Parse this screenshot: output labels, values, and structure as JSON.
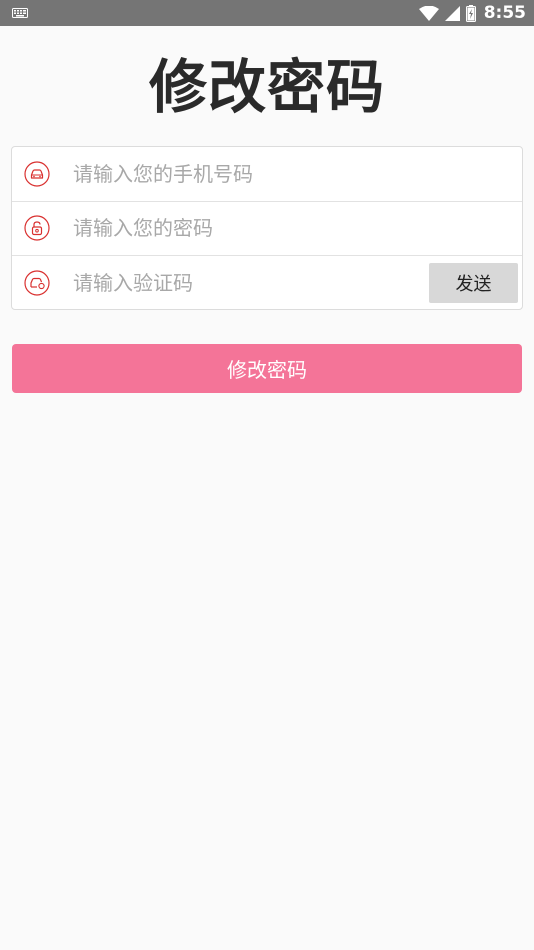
{
  "status_bar": {
    "time": "8:55",
    "icons": [
      "keyboard-icon",
      "wifi-icon",
      "signal-icon",
      "battery-icon"
    ],
    "background": "#757575"
  },
  "page": {
    "title": "修改密码"
  },
  "form": {
    "phone": {
      "placeholder": "请输入您的手机号码",
      "value": "",
      "icon": "car-icon"
    },
    "password": {
      "placeholder": "请输入您的密码",
      "value": "",
      "icon": "lock-icon"
    },
    "code": {
      "placeholder": "请输入验证码",
      "value": "",
      "icon": "car-key-icon"
    },
    "send_label": "发送"
  },
  "submit": {
    "label": "修改密码",
    "color": "#f47498"
  },
  "colors": {
    "icon_accent": "#d9302f",
    "background": "#fafafa"
  }
}
